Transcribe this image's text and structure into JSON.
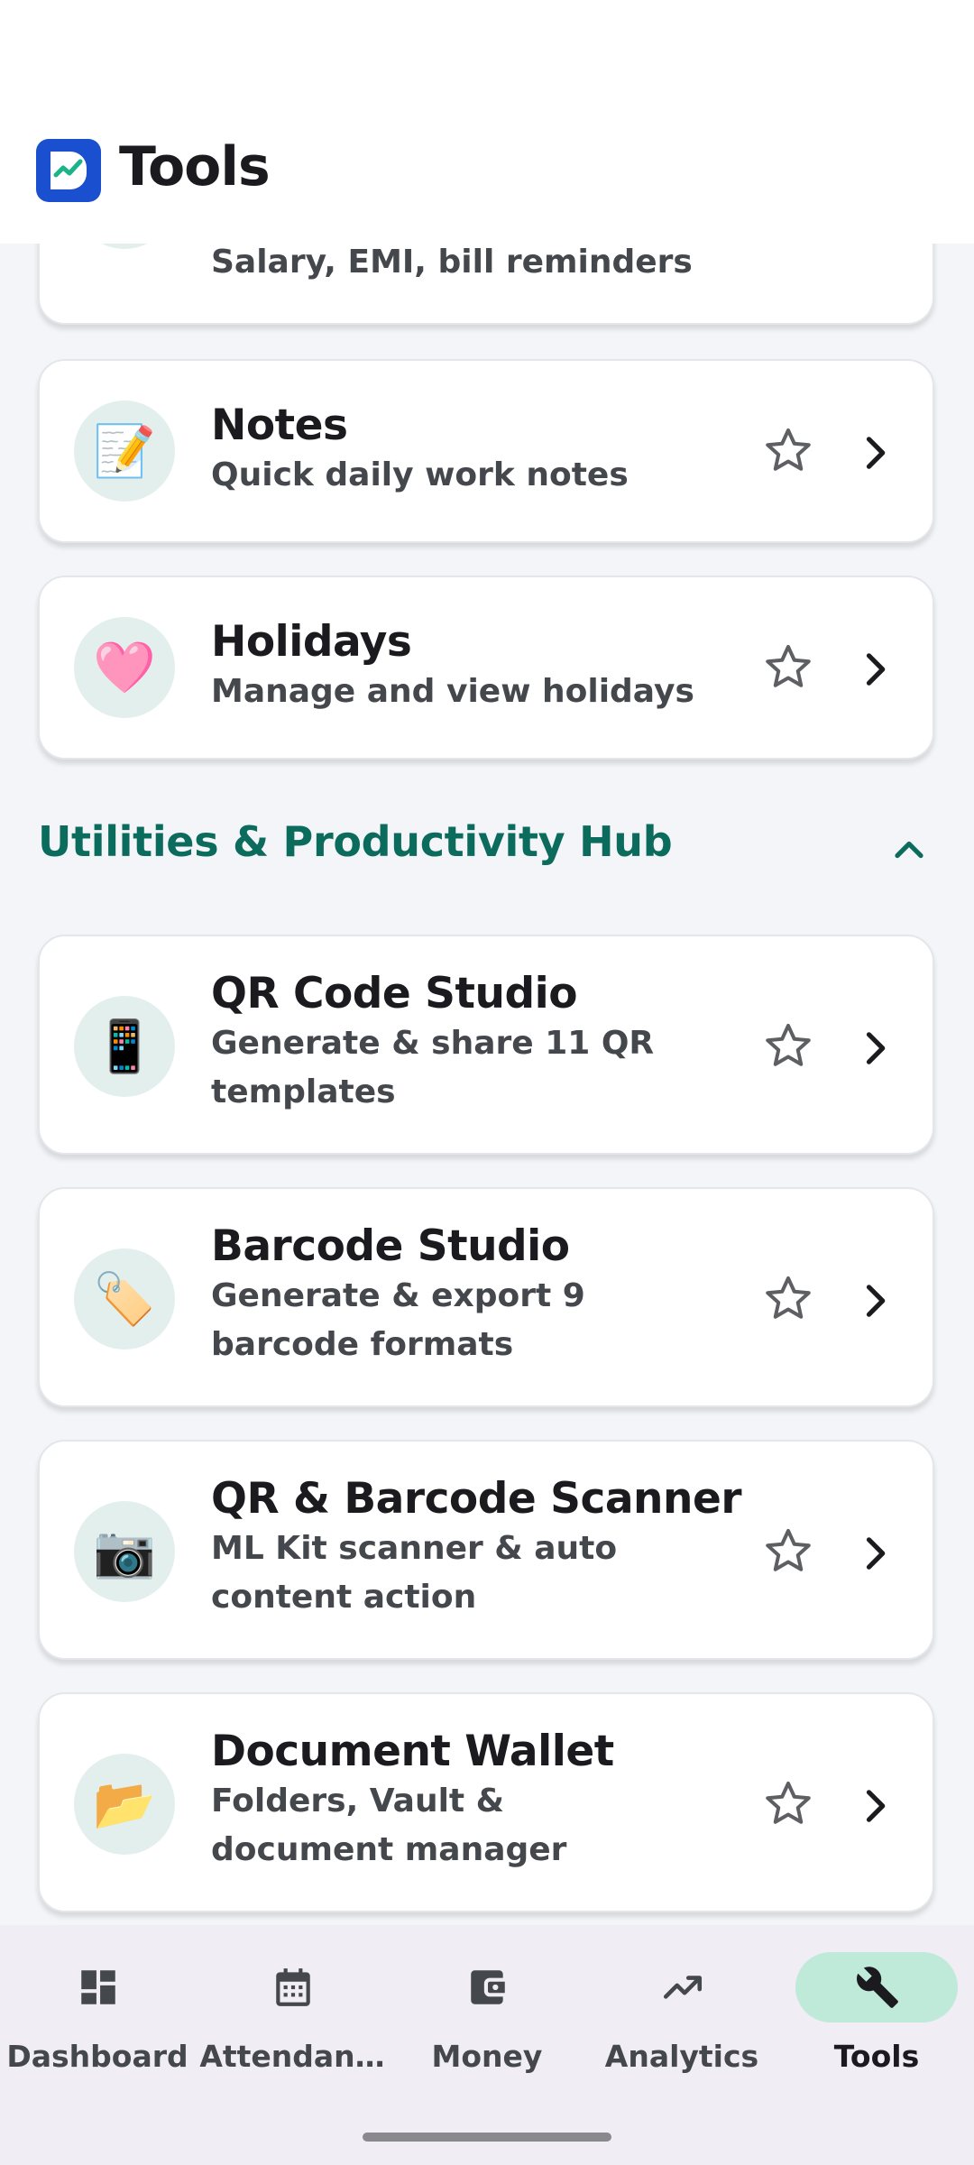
{
  "header": {
    "title": "Tools"
  },
  "cards_top": [
    {
      "icon": "bell-icon",
      "emoji": "🔔",
      "title": "",
      "subtitle": "Salary, EMI, bill reminders"
    },
    {
      "icon": "memo-icon",
      "emoji": "📝",
      "title": "Notes",
      "subtitle": "Quick daily work notes"
    },
    {
      "icon": "heart-icon",
      "emoji": "🩷",
      "title": "Holidays",
      "subtitle": "Manage and view holidays"
    }
  ],
  "section": {
    "title": "Utilities & Productivity Hub"
  },
  "cards_utilities": [
    {
      "icon": "mobile-phone-icon",
      "emoji": "📱",
      "title": "QR Code Studio",
      "subtitle": "Generate & share 11 QR templates"
    },
    {
      "icon": "tag-icon",
      "emoji": "🏷️",
      "title": "Barcode Studio",
      "subtitle": "Generate & export 9 barcode formats"
    },
    {
      "icon": "camera-icon",
      "emoji": "📷",
      "title": "QR & Barcode Scanner",
      "subtitle": "ML Kit scanner & auto content action"
    },
    {
      "icon": "folder-icon",
      "emoji": "📂",
      "title": "Document Wallet",
      "subtitle": "Folders, Vault & document manager"
    }
  ],
  "bottom_nav": [
    {
      "label": "Dashboard",
      "icon": "dashboard-icon",
      "active": false
    },
    {
      "label": "Attendan…",
      "icon": "calendar-icon",
      "active": false
    },
    {
      "label": "Money",
      "icon": "wallet-icon",
      "active": false
    },
    {
      "label": "Analytics",
      "icon": "trending-up-icon",
      "active": false
    },
    {
      "label": "Tools",
      "icon": "wrench-icon",
      "active": true
    }
  ],
  "colors": {
    "accent": "#0b6b5c",
    "active_indicator": "#bfe9d9",
    "logo": "#1a4fcf"
  }
}
